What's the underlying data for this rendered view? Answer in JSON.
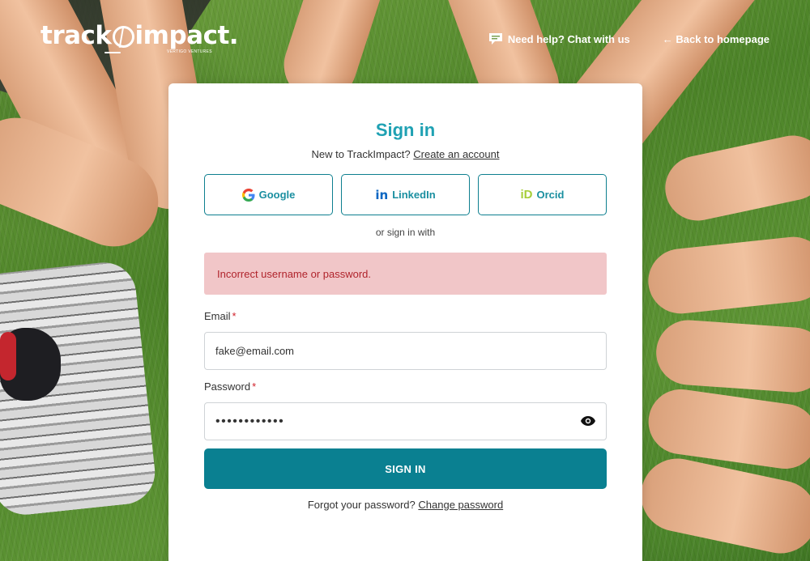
{
  "header": {
    "logo_text_left": "track",
    "logo_text_right": "impact.",
    "logo_sub": "VERTIGO VENTURES",
    "help_link": "Need help? Chat with us",
    "back_link": "← Back to homepage"
  },
  "card": {
    "title": "Sign in",
    "subtitle_prefix": "New to TrackImpact?",
    "create_account": "Create an account",
    "social": [
      {
        "label": "Google",
        "icon": "google-icon"
      },
      {
        "label": "LinkedIn",
        "icon": "linkedin-icon"
      },
      {
        "label": "Orcid",
        "icon": "orcid-icon"
      }
    ],
    "or_text": "or sign in with",
    "error": "Incorrect username or password.",
    "email_label": "Email",
    "email_value": "fake@email.com",
    "password_label": "Password",
    "password_value": "••••••••••••",
    "required_mark": "*",
    "submit": "SIGN IN",
    "forgot_prefix": "Forgot your password?",
    "forgot_link": "Change password"
  },
  "colors": {
    "accent": "#1fa1b3",
    "button": "#0a8091",
    "error_bg": "#f1c6c8",
    "error_text": "#b0242c"
  }
}
